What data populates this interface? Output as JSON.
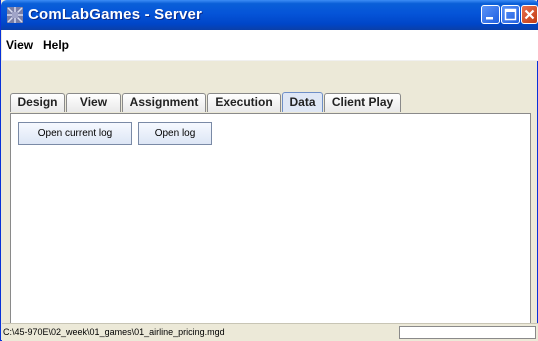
{
  "window": {
    "title": "ComLabGames - Server"
  },
  "menu": {
    "items": [
      {
        "label": "View"
      },
      {
        "label": "Help"
      }
    ]
  },
  "tabs": [
    {
      "label": "Design",
      "active": false
    },
    {
      "label": "View",
      "active": false
    },
    {
      "label": "Assignment",
      "active": false
    },
    {
      "label": "Execution",
      "active": false
    },
    {
      "label": "Data",
      "active": true
    },
    {
      "label": "Client Play",
      "active": false
    }
  ],
  "panel": {
    "buttons": [
      {
        "label": "Open current log"
      },
      {
        "label": "Open log"
      }
    ]
  },
  "status": {
    "path": "C:\\45-970E\\02_week\\01_games\\01_airline_pricing.mgd",
    "right_field": ""
  },
  "colors": {
    "titlebar": "#0554d8",
    "close_button": "#c23b13",
    "window_background": "#ece9d8"
  },
  "icons": [
    "app-icon",
    "minimize-icon",
    "maximize-icon",
    "close-icon"
  ]
}
